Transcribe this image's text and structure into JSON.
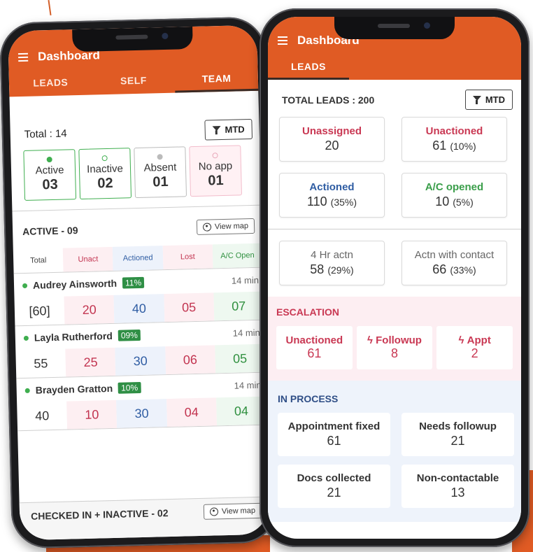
{
  "left": {
    "app_title": "Dashboard",
    "tabs": [
      {
        "label": "LEADS"
      },
      {
        "label": "SELF"
      },
      {
        "label": "TEAM"
      }
    ],
    "total_label": "Total : 14",
    "mtd_label": "MTD",
    "status": [
      {
        "label": "Active",
        "count": "03"
      },
      {
        "label": "Inactive",
        "count": "02"
      },
      {
        "label": "Absent",
        "count": "01"
      },
      {
        "label": "No app",
        "count": "01"
      }
    ],
    "active_section": {
      "title": "ACTIVE - 09",
      "view_map": "View map"
    },
    "columns": [
      "Total",
      "Unact",
      "Actioned",
      "Lost",
      "A/C Open"
    ],
    "people": [
      {
        "name": "Audrey Ainsworth",
        "badge": "11%",
        "time": "14 min",
        "total": "[60]",
        "unact": "20",
        "actioned": "40",
        "lost": "05",
        "ac": "07"
      },
      {
        "name": "Layla Rutherford",
        "badge": "09%",
        "time": "14 min",
        "total": "55",
        "unact": "25",
        "actioned": "30",
        "lost": "06",
        "ac": "05"
      },
      {
        "name": "Brayden Gratton",
        "badge": "10%",
        "time": "14 min",
        "total": "40",
        "unact": "10",
        "actioned": "30",
        "lost": "04",
        "ac": "04"
      }
    ],
    "checked_section": {
      "title": "CHECKED IN + INACTIVE - 02",
      "view_map": "View map"
    }
  },
  "right": {
    "app_title": "Dashboard",
    "tab": "LEADS",
    "total_label": "TOTAL LEADS : 200",
    "mtd_label": "MTD",
    "cards": [
      {
        "label": "Unassigned",
        "value": "20",
        "pct": ""
      },
      {
        "label": "Unactioned",
        "value": "61",
        "pct": "(10%)"
      },
      {
        "label": "Actioned",
        "value": "110",
        "pct": "(35%)"
      },
      {
        "label": "A/C opened",
        "value": "10",
        "pct": "(5%)"
      }
    ],
    "action_cards": [
      {
        "label": "4 Hr actn",
        "value": "58",
        "pct": "(29%)"
      },
      {
        "label": "Actn with contact",
        "value": "66",
        "pct": "(33%)"
      }
    ],
    "escalation": {
      "title": "ESCALATION",
      "items": [
        {
          "label": "Unactioned",
          "value": "61"
        },
        {
          "label": "Followup",
          "value": "8"
        },
        {
          "label": "Appt",
          "value": "2"
        }
      ]
    },
    "in_process": {
      "title": "IN PROCESS",
      "items": [
        {
          "label": "Appointment fixed",
          "value": "61"
        },
        {
          "label": "Needs followup",
          "value": "21"
        },
        {
          "label": "Docs collected",
          "value": "21"
        },
        {
          "label": "Non-contactable",
          "value": "13"
        }
      ]
    }
  },
  "colors": {
    "brand_orange": "#e05b24",
    "red": "#c93853",
    "blue": "#2f5da3",
    "green": "#3a9e4a"
  }
}
